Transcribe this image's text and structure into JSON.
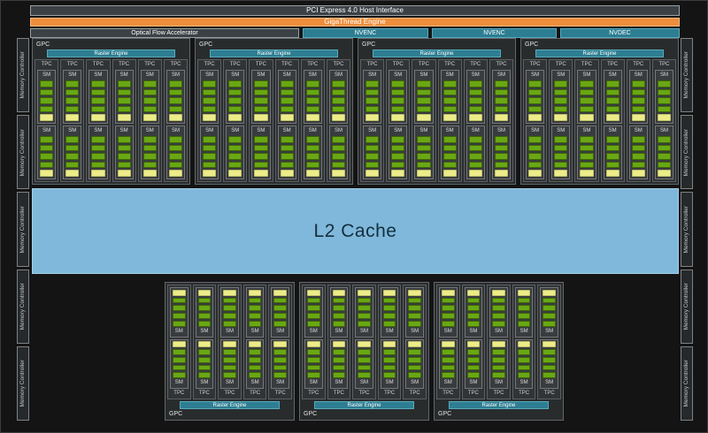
{
  "top_bars": {
    "pcie": "PCI Express 4.0 Host Interface",
    "gigathread": "GigaThread Engine",
    "optical_flow": "Optical Flow Accelerator",
    "nvenc_1": "NVENC",
    "nvenc_2": "NVENC",
    "nvdec": "NVDEC"
  },
  "labels": {
    "gpc": "GPC",
    "raster_engine": "Raster Engine",
    "tpc": "TPC",
    "sm": "SM",
    "l2_cache": "L2 Cache",
    "memory_controller": "Memory Controller"
  },
  "structure": {
    "top_gpc_count": 4,
    "top_tpc_per_gpc": 6,
    "bottom_gpc_count": 3,
    "bottom_tpc_per_gpc": 5,
    "sm_per_tpc": 2,
    "core_rows_per_sm": 4,
    "memory_controllers_per_side": 5
  },
  "colors": {
    "bg": "#141414",
    "panel": "#292c2d",
    "bar-dark": "#3b4145",
    "orange": "#ee8e3c",
    "teal": "#2d7e92",
    "green": "#69a714",
    "yellow": "#ececx8a",
    "l2-blue": "#7fb8db",
    "l2-text": "#142f3e"
  }
}
